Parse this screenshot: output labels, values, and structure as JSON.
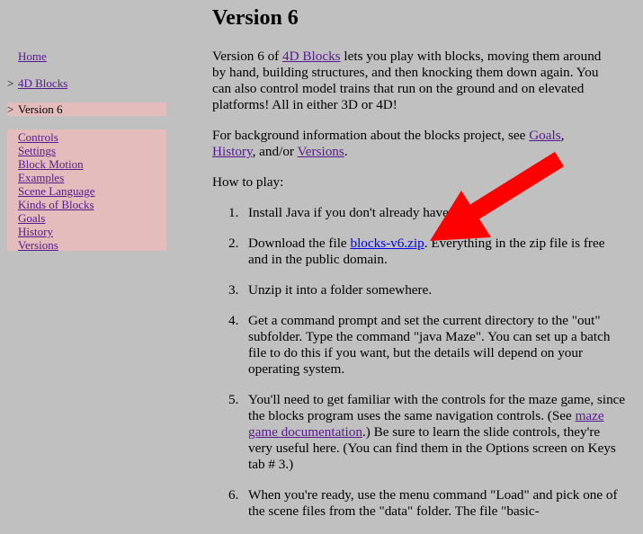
{
  "sidebar": {
    "home_label": "Home",
    "blocks_marker": ">",
    "blocks_label": "4D Blocks",
    "current_marker": ">",
    "current_label": "Version 6",
    "subitems": [
      "Controls",
      "Settings",
      "Block Motion",
      "Examples",
      "Scene Language",
      "Kinds of Blocks",
      "Goals",
      "History",
      "Versions"
    ]
  },
  "main": {
    "title": "Version 6",
    "intro": {
      "before_link": "Version 6 of ",
      "link": "4D Blocks",
      "after_link": " lets you play with blocks, moving them around by hand, building structures, and then knocking them down again. You can also control model trains that run on the ground and on elevated platforms! All in either 3D or 4D!"
    },
    "background": {
      "text1": "For background information about the blocks project, see ",
      "link_goals": "Goals",
      "sep1": ",",
      "link_history": "History",
      "sep2": ", and/or ",
      "link_versions": "Versions",
      "end": "."
    },
    "howto": "How to play:",
    "steps": {
      "s1": {
        "num": "1.",
        "text": "Install Java if you don't already have it."
      },
      "s2": {
        "num": "2.",
        "before": "Download the file ",
        "link": "blocks-v6.zip",
        "after": ". Everything in the zip file is free and in the public domain."
      },
      "s3": {
        "num": "3.",
        "text": "Unzip it into a folder somewhere."
      },
      "s4": {
        "num": "4.",
        "text": "Get a command prompt and set the current directory to the \"out\" subfolder. Type the command \"java Maze\". You can set up a batch file to do this if you want, but the details will depend on your operating system."
      },
      "s5": {
        "num": "5.",
        "before": "You'll need to get familiar with the controls for the maze game, since the blocks program uses the same navigation controls. (See ",
        "link": "maze game documentation",
        "after": ".) Be sure to learn the slide controls, they're very useful here. (You can find them in the Options screen on Keys tab # 3.)"
      },
      "s6": {
        "num": "6.",
        "text": "When you're ready, use the menu command \"Load\" and pick one of the scene files from the \"data\" folder. The file \"basic-"
      }
    }
  },
  "annotation": {
    "icon": "red-arrow-icon",
    "color": "#ff0000"
  }
}
